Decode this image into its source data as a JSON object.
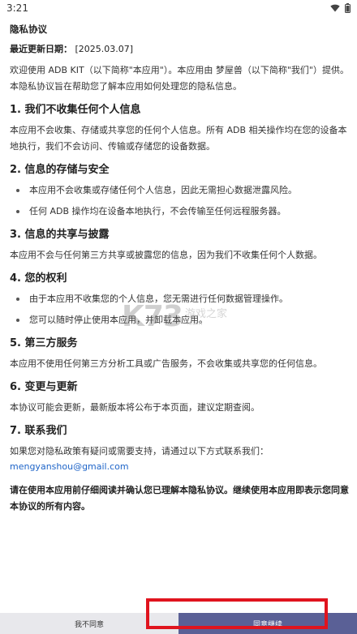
{
  "status_bar": {
    "time": "3:21",
    "icons": [
      "wifi-icon",
      "battery-icon"
    ]
  },
  "document": {
    "title": "隐私协议",
    "updated_label": "最近更新日期：",
    "updated_value": "[2025.03.07]",
    "intro": "欢迎使用 ADB KIT（以下简称\"本应用\"）。本应用由 梦屋兽（以下简称\"我们\"）提供。本隐私协议旨在帮助您了解本应用如何处理您的隐私信息。",
    "sections": [
      {
        "title": "1. 我们不收集任何个人信息",
        "para": "本应用不会收集、存储或共享您的任何个人信息。所有 ADB 相关操作均在您的设备本地执行，我们不会访问、传输或存储您的设备数据。"
      },
      {
        "title": "2. 信息的存储与安全",
        "bullets": [
          "本应用不会收集或存储任何个人信息，因此无需担心数据泄露风险。",
          "任何 ADB 操作均在设备本地执行，不会传输至任何远程服务器。"
        ]
      },
      {
        "title": "3. 信息的共享与披露",
        "para": "本应用不会与任何第三方共享或披露您的信息，因为我们不收集任何个人数据。"
      },
      {
        "title": "4. 您的权利",
        "bullets": [
          "由于本应用不收集您的个人信息，您无需进行任何数据管理操作。",
          "您可以随时停止使用本应用，并卸载本应用。"
        ]
      },
      {
        "title": "5. 第三方服务",
        "para": "本应用不使用任何第三方分析工具或广告服务，不会收集或共享您的任何信息。"
      },
      {
        "title": "6. 变更与更新",
        "para": "本协议可能会更新，最新版本将公布于本页面，建议定期查阅。"
      },
      {
        "title": "7. 联系我们",
        "para": "如果您对隐私政策有疑问或需要支持，请通过以下方式联系我们：",
        "email": "mengyanshou@gmail.com"
      }
    ],
    "closing": "请在使用本应用前仔细阅读并确认您已理解本隐私协议。继续使用本应用即表示您同意本协议的所有内容。"
  },
  "watermark": {
    "brand": "K73",
    "sub": "游戏之家",
    "url": ".com"
  },
  "buttons": {
    "decline_label": "我不同意",
    "agree_label": "同意继续"
  },
  "colors": {
    "agree_button_bg": "#5a6096",
    "decline_button_bg": "#e8e8ec",
    "highlight_border": "#e0141e",
    "link": "#1e64c8"
  }
}
